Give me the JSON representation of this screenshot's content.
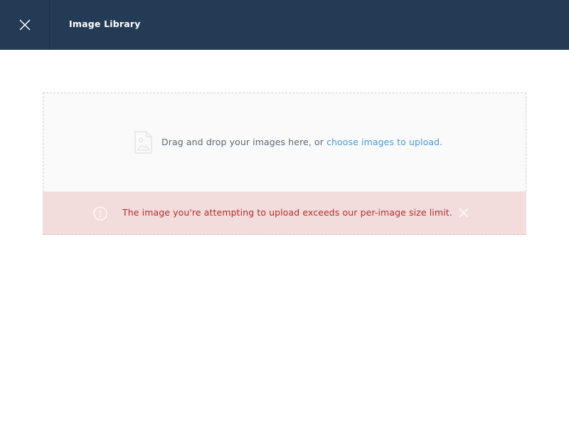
{
  "header": {
    "title": "Image Library",
    "close_icon": "close-icon",
    "background_color": "#243b55"
  },
  "dropzone": {
    "text": "Drag and drop your images here, or ",
    "link_text": "choose images to upload.",
    "icon": "image-file-icon",
    "link_color": "#4b9ad1"
  },
  "error": {
    "message": "The image you're attempting to upload exceeds our per-image size limit.",
    "icon": "info-circle-icon",
    "dismiss_icon": "close-icon",
    "text_color": "#b22d2d",
    "background_color": "#f3dcdc"
  }
}
